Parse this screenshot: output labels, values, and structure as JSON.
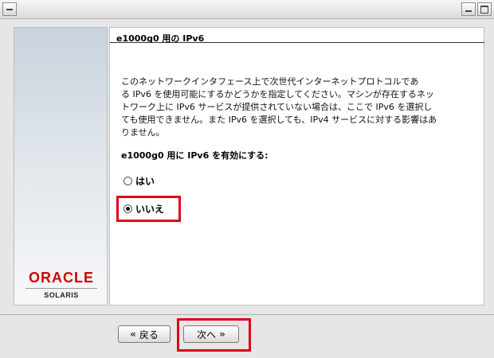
{
  "window": {
    "title": ""
  },
  "heading": "e1000g0 用の IPv6",
  "description": "このネットワークインタフェース上で次世代インターネットプロトコルである IPv6 を使用可能にするかどうかを指定してください。マシンが存在するネットワーク上に IPv6 サービスが提供されていない場合は、ここで IPv6 を選択しても使用できません。また IPv6 を選択しても、IPv4 サービスに対する影響はありません。",
  "description_lines": [
    "このネットワークインタフェース上で次世代インターネットプロトコルであ",
    "る IPv6 を使用可能にするかどうかを指定してください。マシンが存在するネッ",
    "トワーク上に IPv6 サービスが提供されていない場合は、ここで IPv6 を選択し",
    "ても使用できません。また IPv6 を選択しても、IPv4 サービスに対する影響はあ",
    "りません。"
  ],
  "question": "e1000g0 用に IPv6 を有効にする:",
  "options": [
    {
      "label": "はい",
      "selected": false
    },
    {
      "label": "いいえ",
      "selected": true
    }
  ],
  "buttons": {
    "back_label": "戻る",
    "back_icon": "double-chevron-left-icon",
    "next_label": "次へ",
    "next_icon": "double-chevron-right-icon"
  },
  "logo": {
    "brand": "ORACLE",
    "product": "SOLARIS"
  },
  "colors": {
    "highlight": "#e0001b",
    "brand_red": "#d40000"
  }
}
